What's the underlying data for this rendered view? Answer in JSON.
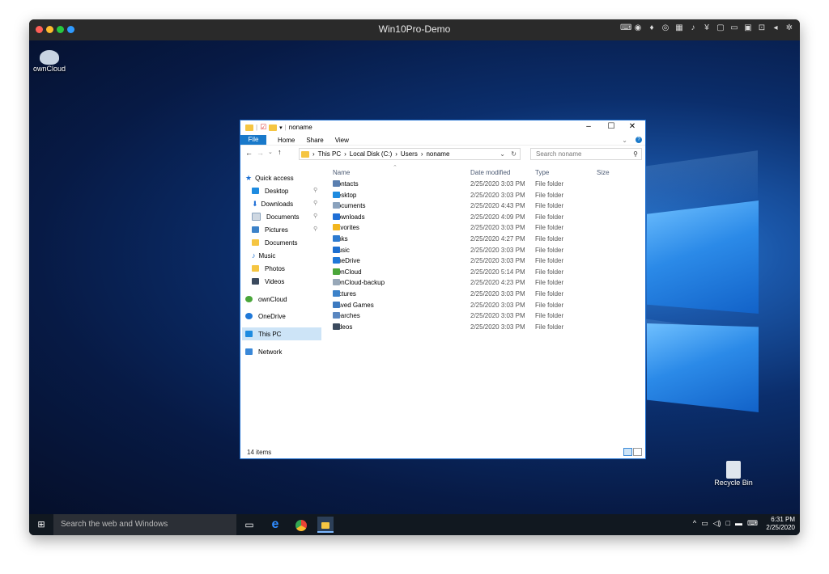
{
  "vm_window": {
    "title": "Win10Pro-Demo",
    "traffic_lights": [
      "#ff5f57",
      "#febc2e",
      "#28c840",
      "#2f9bff"
    ],
    "toolbar_icons": [
      "keyboard-icon",
      "record-icon",
      "mic-icon",
      "camera-icon",
      "network-icon",
      "sound-icon",
      "usb-icon",
      "printer-icon",
      "display-icon",
      "shared-folder-icon",
      "screen-icon",
      "arrow-left-icon",
      "settings-icon"
    ]
  },
  "desktop": {
    "icons": [
      {
        "name": "owncloud",
        "label": "ownCloud"
      },
      {
        "name": "recycle-bin",
        "label": "Recycle Bin"
      }
    ]
  },
  "explorer": {
    "title": "noname",
    "window_buttons": [
      "–",
      "☐",
      "✕"
    ],
    "ribbon_tabs": [
      "File",
      "Home",
      "Share",
      "View"
    ],
    "address_path": [
      "This PC",
      "Local Disk (C:)",
      "Users",
      "noname"
    ],
    "search_placeholder": "Search noname",
    "nav": [
      {
        "label": "Quick access",
        "icon": "star-icon",
        "pinned": false
      },
      {
        "label": "Desktop",
        "icon": "desktop-icon",
        "pinned": true
      },
      {
        "label": "Downloads",
        "icon": "download-icon",
        "pinned": true
      },
      {
        "label": "Documents",
        "icon": "document-icon",
        "pinned": true
      },
      {
        "label": "Pictures",
        "icon": "picture-icon",
        "pinned": true
      },
      {
        "label": "Documents",
        "icon": "folder-icon",
        "pinned": false
      },
      {
        "label": "Music",
        "icon": "music-icon",
        "pinned": false
      },
      {
        "label": "Photos",
        "icon": "folder-icon",
        "pinned": false
      },
      {
        "label": "Videos",
        "icon": "video-icon",
        "pinned": false
      },
      {
        "label": "ownCloud",
        "icon": "owncloud-icon",
        "pinned": false
      },
      {
        "label": "OneDrive",
        "icon": "cloud-icon",
        "pinned": false
      },
      {
        "label": "This PC",
        "icon": "computer-icon",
        "pinned": false,
        "selected": true
      },
      {
        "label": "Network",
        "icon": "network-icon",
        "pinned": false
      }
    ],
    "columns": [
      "Name",
      "Date modified",
      "Type",
      "Size"
    ],
    "files": [
      {
        "name": "Contacts",
        "date": "2/25/2020 3:03 PM",
        "type": "File folder",
        "icon": "contacts-icon",
        "color": "#5a7fb0"
      },
      {
        "name": "Desktop",
        "date": "2/25/2020 3:03 PM",
        "type": "File folder",
        "icon": "desktop-icon",
        "color": "#1e8be0"
      },
      {
        "name": "Documents",
        "date": "2/25/2020 4:43 PM",
        "type": "File folder",
        "icon": "document-icon",
        "color": "#8aa2bd"
      },
      {
        "name": "Downloads",
        "date": "2/25/2020 4:09 PM",
        "type": "File folder",
        "icon": "download-icon",
        "color": "#1f6fd6"
      },
      {
        "name": "Favorites",
        "date": "2/25/2020 3:03 PM",
        "type": "File folder",
        "icon": "star-icon",
        "color": "#f2b51d"
      },
      {
        "name": "Links",
        "date": "2/25/2020 4:27 PM",
        "type": "File folder",
        "icon": "link-icon",
        "color": "#2e7bd0"
      },
      {
        "name": "Music",
        "date": "2/25/2020 3:03 PM",
        "type": "File folder",
        "icon": "music-icon",
        "color": "#1d6fd0"
      },
      {
        "name": "OneDrive",
        "date": "2/25/2020 3:03 PM",
        "type": "File folder",
        "icon": "cloud-icon",
        "color": "#1f78d8"
      },
      {
        "name": "ownCloud",
        "date": "2/25/2020 5:14 PM",
        "type": "File folder",
        "icon": "owncloud-icon",
        "color": "#4aa63a"
      },
      {
        "name": "ownCloud-backup",
        "date": "2/25/2020 4:23 PM",
        "type": "File folder",
        "icon": "owncloud-icon",
        "color": "#98a8b8"
      },
      {
        "name": "Pictures",
        "date": "2/25/2020 3:03 PM",
        "type": "File folder",
        "icon": "picture-icon",
        "color": "#3c82c9"
      },
      {
        "name": "Saved Games",
        "date": "2/25/2020 3:03 PM",
        "type": "File folder",
        "icon": "games-icon",
        "color": "#3d7ac0"
      },
      {
        "name": "Searches",
        "date": "2/25/2020 3:03 PM",
        "type": "File folder",
        "icon": "search-icon",
        "color": "#5a87c0"
      },
      {
        "name": "Videos",
        "date": "2/25/2020 3:03 PM",
        "type": "File folder",
        "icon": "video-icon",
        "color": "#3b4a5e"
      }
    ],
    "status": "14 items"
  },
  "taskbar": {
    "search_placeholder": "Search the web and Windows",
    "apps": [
      "task-view-icon",
      "edge-icon",
      "chrome-icon",
      "file-explorer-icon"
    ],
    "time": "6:31 PM",
    "date": "2/25/2020"
  }
}
